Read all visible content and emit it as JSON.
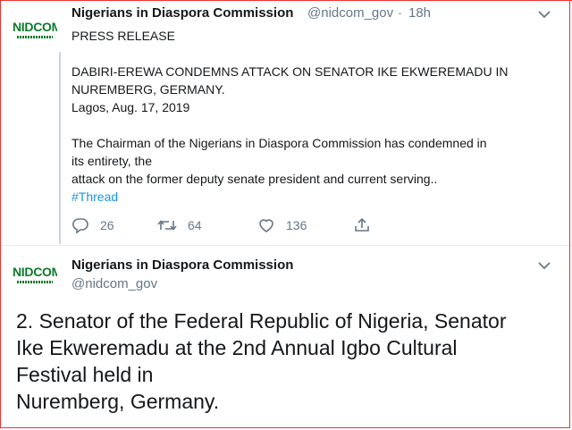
{
  "tweet1": {
    "author_name": "Nigerians in Diaspora Commission",
    "handle": "@nidcom_gov",
    "separator": "·",
    "time": "18h",
    "logo_text": "NIDCOM",
    "lines": [
      "PRESS RELEASE",
      "",
      "DABIRI-EREWA CONDEMNS ATTACK ON SENATOR IKE EKWEREMADU IN",
      "NUREMBERG, GERMANY.",
      "Lagos, Aug. 17, 2019",
      "",
      "The Chairman of the Nigerians in Diaspora Commission has condemned in",
      "its entirety, the",
      "attack on the former deputy senate president and current serving.."
    ],
    "hashtag": "#Thread",
    "actions": {
      "replies": "26",
      "retweets": "64",
      "likes": "136"
    }
  },
  "tweet2": {
    "author_name": "Nigerians in Diaspora Commission",
    "handle": "@nidcom_gov",
    "logo_text": "NIDCOM",
    "lines": [
      "2. Senator of the Federal Republic of Nigeria, Senator",
      "Ike Ekweremadu at the 2nd Annual Igbo Cultural",
      "Festival held in",
      "Nuremberg, Germany."
    ]
  },
  "colors": {
    "text": "#14171a",
    "secondary": "#657786",
    "link": "#1b95e0",
    "logo_green": "#0a7a2a",
    "frame": "#ee3333"
  }
}
